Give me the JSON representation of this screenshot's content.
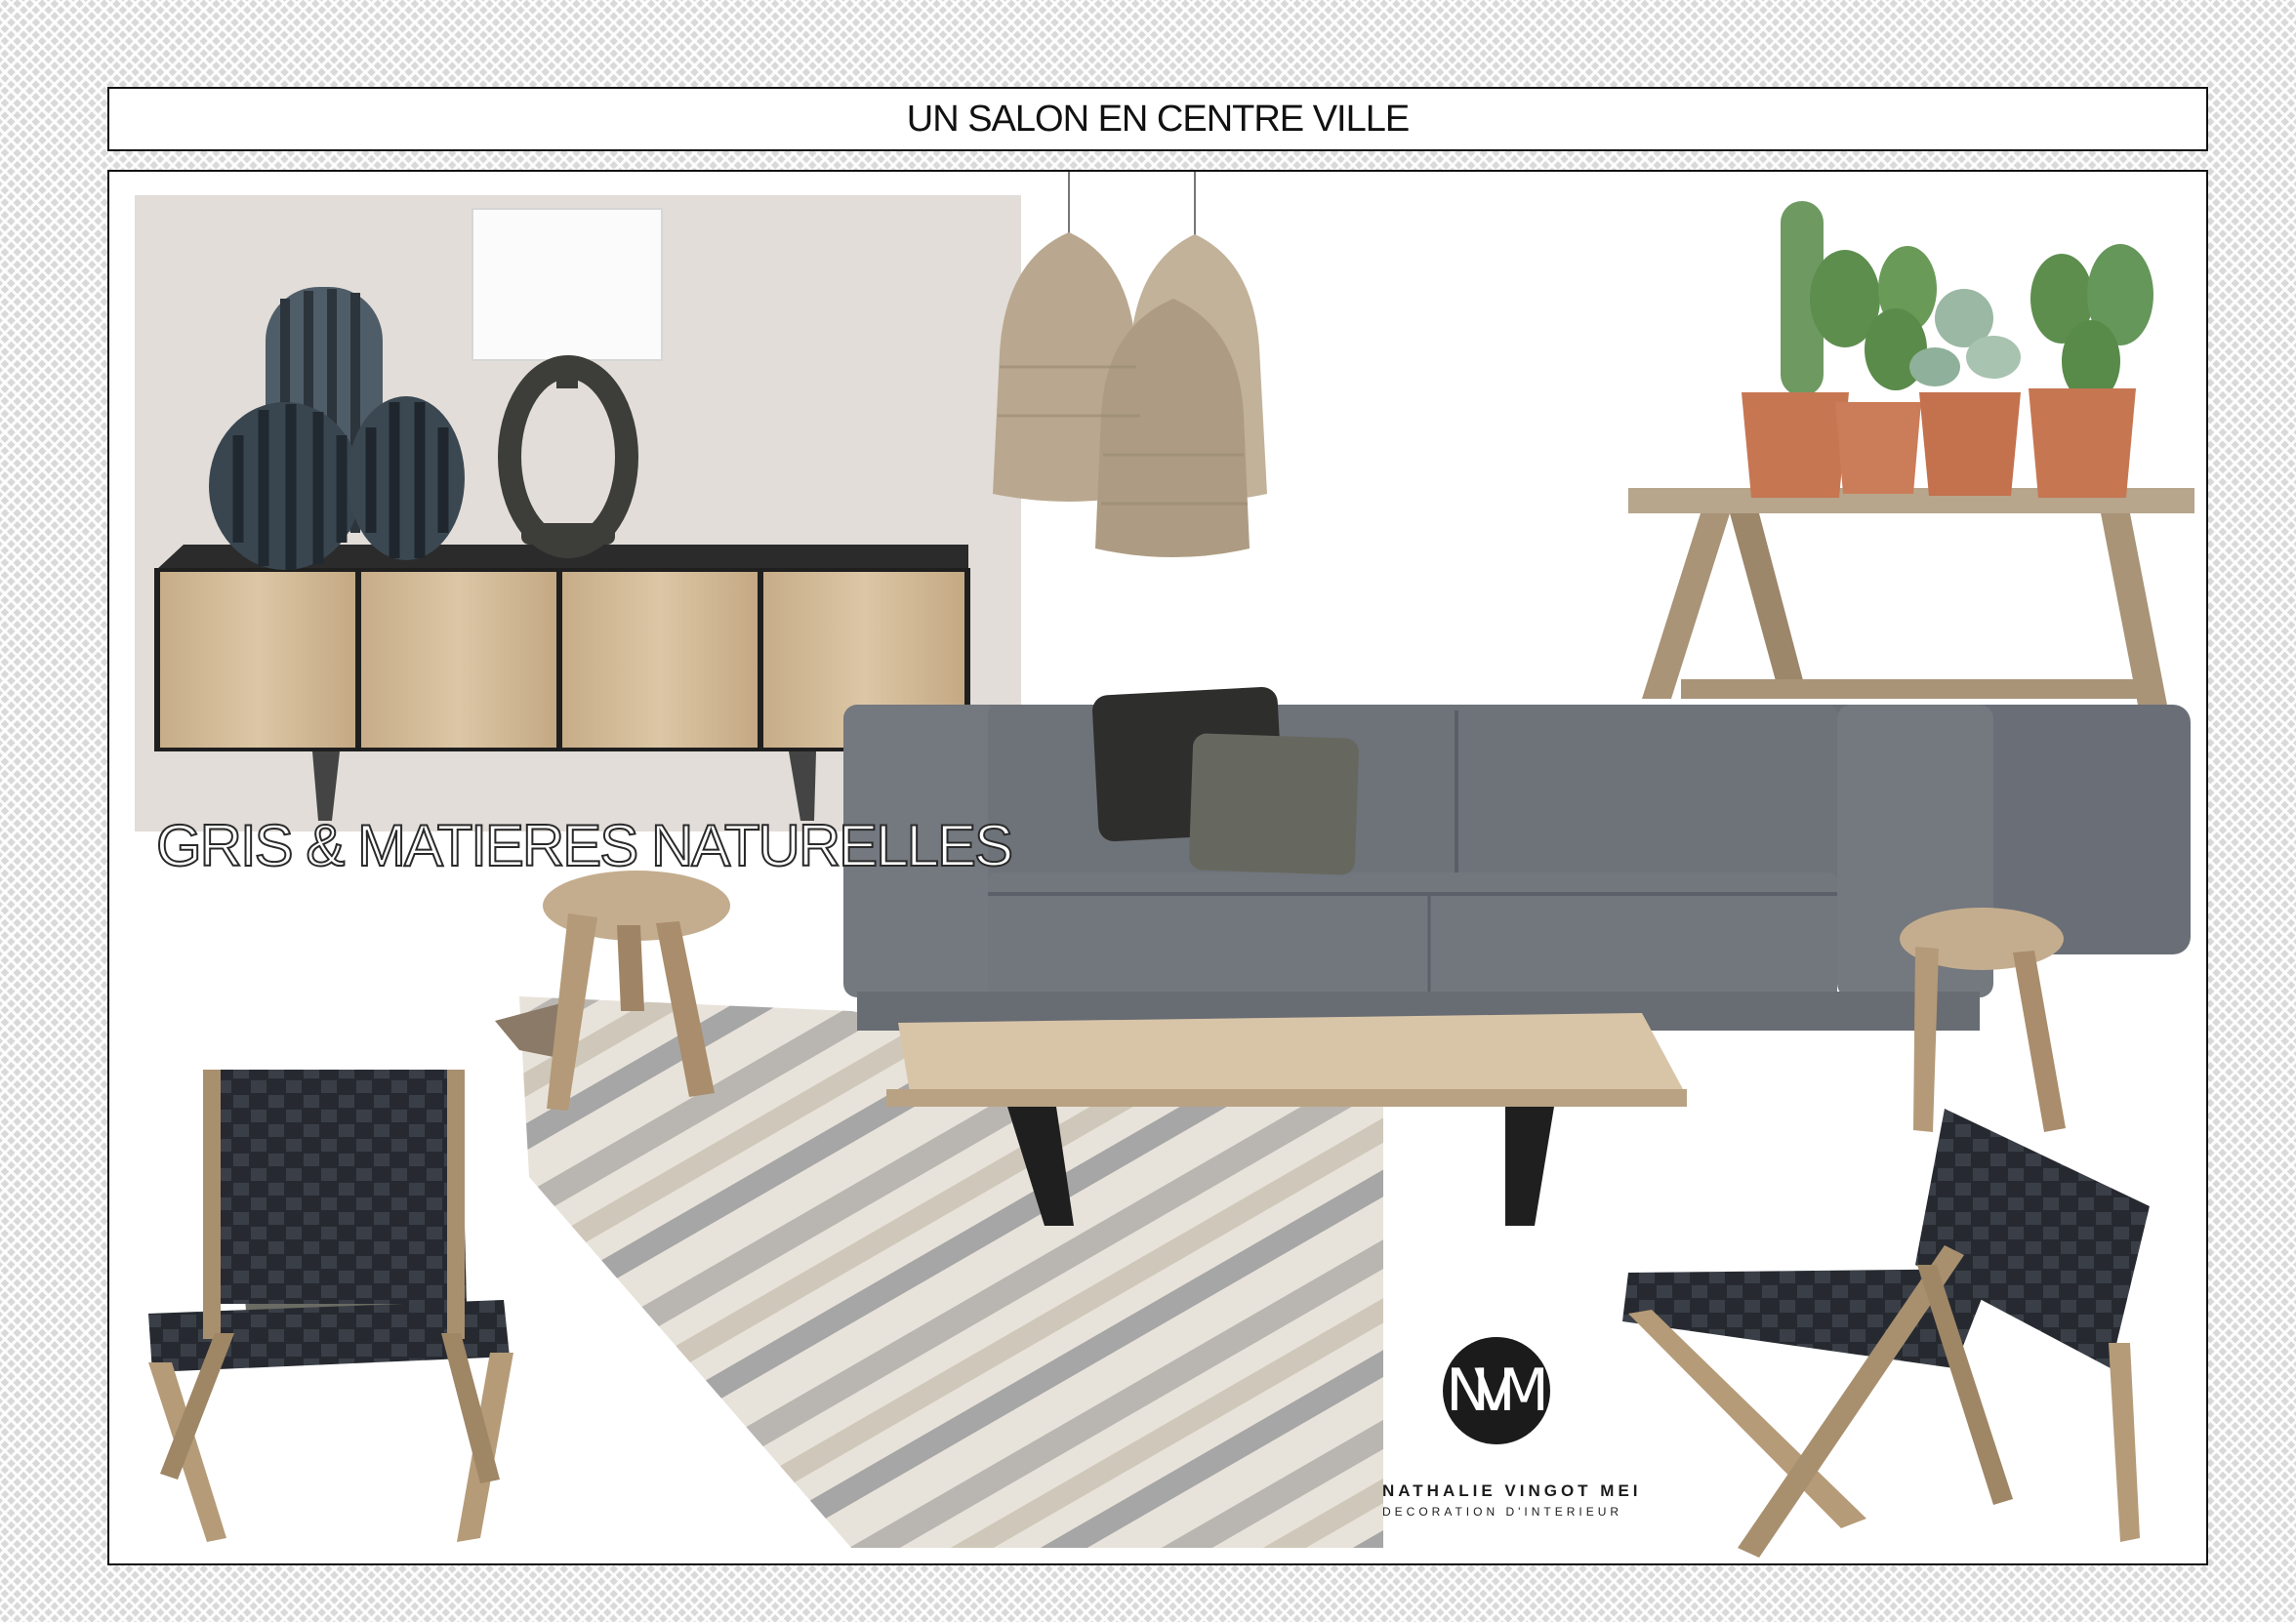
{
  "header": {
    "title": "UN SALON EN CENTRE VILLE"
  },
  "board": {
    "tagline": "GRIS & MATIERES NATURELLES",
    "items": [
      {
        "name": "sideboard",
        "icon": "sideboard-icon"
      },
      {
        "name": "vases",
        "icon": "vase-icon"
      },
      {
        "name": "table-lamp",
        "icon": "lamp-icon"
      },
      {
        "name": "pendant-lamps",
        "icon": "pendant-lamp-icon"
      },
      {
        "name": "cactus-plants",
        "icon": "cactus-icon"
      },
      {
        "name": "console-bench",
        "icon": "bench-icon"
      },
      {
        "name": "sofa",
        "icon": "sofa-icon"
      },
      {
        "name": "cushions",
        "icon": "cushion-icon"
      },
      {
        "name": "stools",
        "icon": "stool-icon"
      },
      {
        "name": "rug",
        "icon": "rug-icon"
      },
      {
        "name": "coffee-table",
        "icon": "coffee-table-icon"
      },
      {
        "name": "lounge-chairs",
        "icon": "lounge-chair-icon"
      }
    ]
  },
  "logo": {
    "monogram": "NVM",
    "name": "NATHALIE VINGOT MEI",
    "subtitle": "DECORATION D'INTERIEUR"
  },
  "colors": {
    "beige_panel": "#e2ddd8",
    "sofa_grey": "#6f737b",
    "wood": "#c9b08c",
    "terracotta": "#c87a55"
  }
}
